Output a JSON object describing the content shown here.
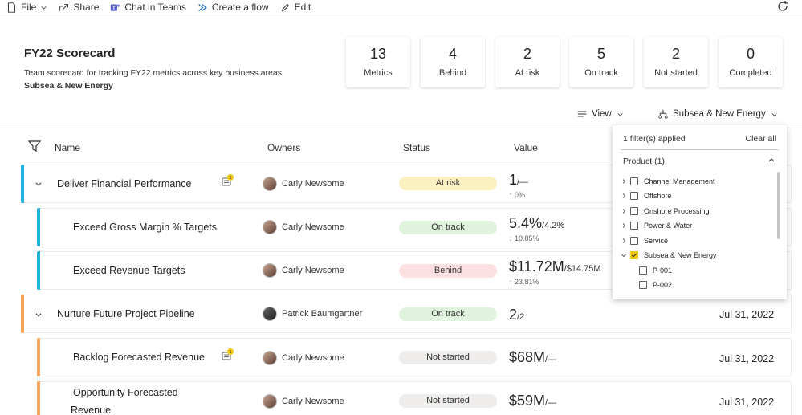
{
  "toolbar": {
    "file": "File",
    "share": "Share",
    "chat": "Chat in Teams",
    "flow": "Create a flow",
    "edit": "Edit"
  },
  "scorecard": {
    "title": "FY22 Scorecard",
    "description": "Team scorecard for tracking FY22 metrics across key business areas",
    "filter_label": "Subsea & New Energy"
  },
  "kpis": [
    {
      "value": "13",
      "label": "Metrics"
    },
    {
      "value": "4",
      "label": "Behind"
    },
    {
      "value": "2",
      "label": "At risk"
    },
    {
      "value": "5",
      "label": "On track"
    },
    {
      "value": "2",
      "label": "Not started"
    },
    {
      "value": "0",
      "label": "Completed"
    }
  ],
  "controls": {
    "view": "View",
    "filter": "Subsea & New Energy"
  },
  "columns": {
    "name": "Name",
    "owners": "Owners",
    "status": "Status",
    "value": "Value"
  },
  "rows": [
    {
      "name": "Deliver Financial Performance",
      "owner": "Carly Newsome",
      "status": "At risk",
      "value": "1",
      "target": "/—",
      "change": "↑ 0%",
      "due": "",
      "note_count": "1"
    },
    {
      "name": "Exceed Gross Margin % Targets",
      "owner": "Carly Newsome",
      "status": "On track",
      "value": "5.4%",
      "target": "/4.2%",
      "change": "↓ 10.85%",
      "due": ""
    },
    {
      "name": "Exceed Revenue Targets",
      "owner": "Carly Newsome",
      "status": "Behind",
      "value": "$11.72M",
      "target": "/$14.75M",
      "change": "↑ 23.81%",
      "due": ""
    },
    {
      "name": "Nurture Future Project Pipeline",
      "owner": "Patrick Baumgartner",
      "status": "On track",
      "value": "2",
      "target": "/2",
      "change": "",
      "due": "Jul 31, 2022"
    },
    {
      "name": "Backlog Forecasted Revenue",
      "owner": "Carly Newsome",
      "status": "Not started",
      "value": "$68M",
      "target": "/—",
      "change": "",
      "due": "Jul 31, 2022",
      "note_count": "1"
    },
    {
      "name_line1": "Opportunity Forecasted",
      "name_line2": "Revenue",
      "owner": "Carly Newsome",
      "status": "Not started",
      "value": "$59M",
      "target": "/—",
      "change": "",
      "due": "Jul 31, 2022"
    }
  ],
  "status_colors": {
    "At risk": "#fcf0c0",
    "On track": "#dff3dd",
    "Behind": "#fde0e2",
    "Not started": "#eeedec"
  },
  "accent_colors": {
    "financial": "#1fb3e0",
    "pipeline": "#f7a456"
  },
  "filter_panel": {
    "applied": "1 filter(s) applied",
    "clear": "Clear all",
    "product": "Product (1)",
    "items": [
      {
        "label": "Channel Management",
        "checked": false
      },
      {
        "label": "Offshore",
        "checked": false
      },
      {
        "label": "Onshore Processing",
        "checked": false
      },
      {
        "label": "Power & Water",
        "checked": false
      },
      {
        "label": "Service",
        "checked": false
      },
      {
        "label": "Subsea & New Energy",
        "checked": true
      }
    ],
    "children": [
      {
        "label": "P-001",
        "checked": false
      },
      {
        "label": "P-002",
        "checked": false
      }
    ]
  }
}
